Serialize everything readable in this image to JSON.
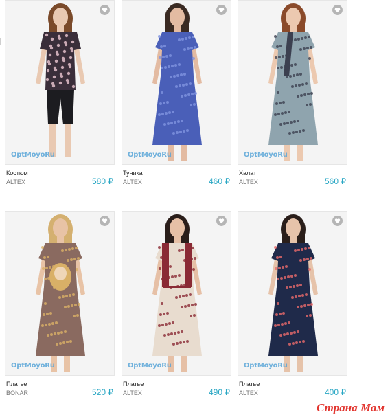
{
  "products": [
    {
      "name": "Костюм",
      "brand": "ALTEX",
      "price": "580 ₽",
      "watermark": "OptMoyoRu",
      "fav_icon": "heart-icon",
      "colors": {
        "skin": "#e9c9b2",
        "hair": "#7a4a2a",
        "top": "#3a2e3a",
        "top_accent": "#c9a9b4",
        "bottom": "#1c1c20",
        "bg": "#f4f4f4"
      }
    },
    {
      "name": "Туника",
      "brand": "ALTEX",
      "price": "460 ₽",
      "watermark": "OptMoyoRu",
      "fav_icon": "heart-icon",
      "colors": {
        "skin": "#e3bba2",
        "hair": "#3a2a22",
        "top": "#4a5fb8",
        "top_accent": "#7f93e0",
        "bottom": "#4a5fb8",
        "bg": "#f4f4f4"
      }
    },
    {
      "name": "Халат",
      "brand": "ALTEX",
      "price": "560 ₽",
      "watermark": "OptMoyoRu",
      "fav_icon": "heart-icon",
      "colors": {
        "skin": "#ecc9b0",
        "hair": "#8a4a2a",
        "top": "#8fa4ae",
        "top_accent": "#3c4050",
        "bottom": "#8fa4ae",
        "bg": "#f4f4f4"
      }
    },
    {
      "name": "Платье",
      "brand": "BONAR",
      "price": "520 ₽",
      "watermark": "OptMoyoRu",
      "fav_icon": "heart-icon",
      "colors": {
        "skin": "#e8c3a6",
        "hair": "#d4b070",
        "top": "#8a6a60",
        "top_accent": "#d9b067",
        "bottom": "#4a3a30",
        "bg": "#f4f4f4"
      }
    },
    {
      "name": "Платье",
      "brand": "ALTEX",
      "price": "490 ₽",
      "watermark": "OptMoyoRu",
      "fav_icon": "heart-icon",
      "colors": {
        "skin": "#e6c0a6",
        "hair": "#2a1e1a",
        "top": "#e8dccf",
        "top_accent": "#8a2a35",
        "bottom": "#5fb8a0",
        "bg": "#f4f4f4"
      }
    },
    {
      "name": "Платье",
      "brand": "ALTEX",
      "price": "400 ₽",
      "watermark": "OptMoyoRu",
      "fav_icon": "heart-icon",
      "colors": {
        "skin": "#e6c3aa",
        "hair": "#2a1e1a",
        "top": "#1f2a4a",
        "top_accent": "#e86a6a",
        "bottom": "#1f2a4a",
        "bg": "#f4f4f4"
      }
    }
  ],
  "site_logo": "Страна Мам"
}
